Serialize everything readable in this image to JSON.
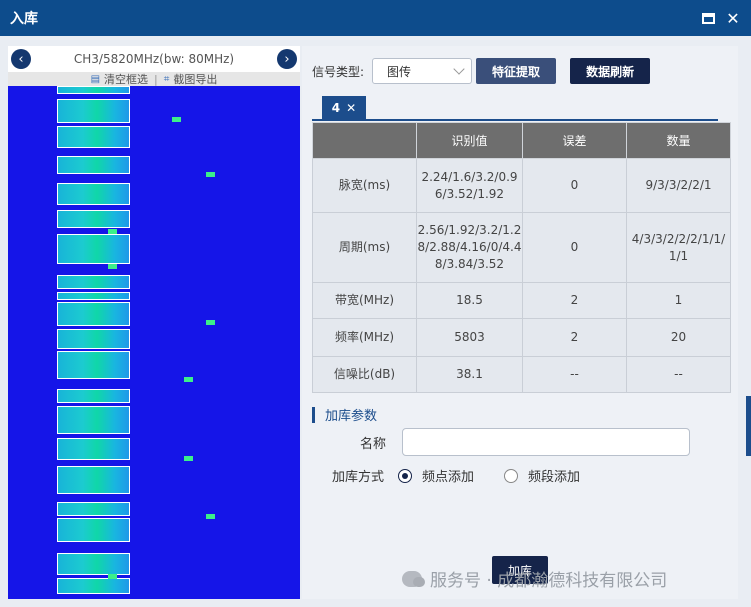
{
  "window": {
    "title": "入库"
  },
  "spectrum": {
    "channel_label": "CH3/5820MHz(bw: 80MHz)",
    "prev_icon": "chevron-left-icon",
    "next_icon": "chevron-right-icon",
    "clear_label": "清空框选",
    "export_label": "截图导出",
    "background_color": "#1515e8",
    "highlight_color": "#3cf08a"
  },
  "toolbar": {
    "signal_type_label": "信号类型:",
    "signal_type_value": "图传",
    "extract_label": "特征提取",
    "refresh_label": "数据刷新"
  },
  "tab": {
    "label": "4",
    "close": "✕"
  },
  "table": {
    "headers": [
      "",
      "识别值",
      "误差",
      "数量"
    ],
    "rows": [
      [
        "脉宽(ms)",
        "2.24/1.6/3.2/0.96/3.52/1.92",
        "0",
        "9/3/3/2/2/1"
      ],
      [
        "周期(ms)",
        "2.56/1.92/3.2/1.28/2.88/4.16/0/4.48/3.84/3.52",
        "0",
        "4/3/3/2/2/2/1/1/1/1"
      ],
      [
        "带宽(MHz)",
        "18.5",
        "2",
        "1"
      ],
      [
        "频率(MHz)",
        "5803",
        "2",
        "20"
      ],
      [
        "信噪比(dB)",
        "38.1",
        "--",
        "--"
      ]
    ]
  },
  "params": {
    "section_title": "加库参数",
    "name_label": "名称",
    "name_value": "",
    "mode_label": "加库方式",
    "mode_options": [
      "频点添加",
      "频段添加"
    ],
    "mode_selected": "频点添加",
    "submit_label": "加库"
  },
  "watermark": {
    "text": "服务号 · 成都瀚德科技有限公司"
  },
  "colors": {
    "titlebar": "#0d4c8c",
    "accent": "#1c4d8c",
    "button_dark": "#15244a"
  }
}
